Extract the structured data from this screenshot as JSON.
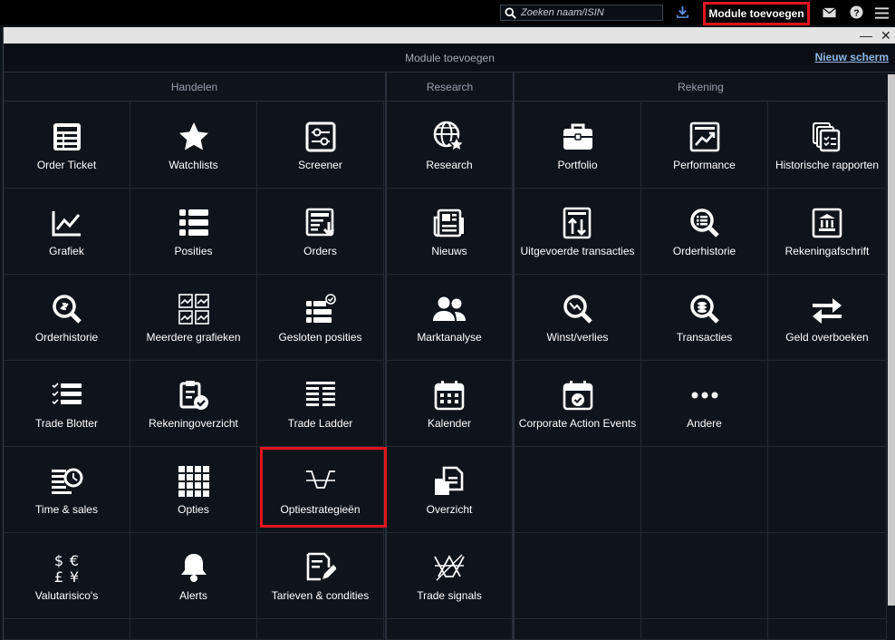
{
  "topbar": {
    "search_placeholder": "Zoeken naam/ISIN",
    "add_module_label": "Module toevoegen"
  },
  "window": {
    "title": "Module toevoegen",
    "new_screen_link": "Nieuw scherm",
    "minimize_glyph": "—",
    "close_glyph": "✕"
  },
  "sections": {
    "handelen": "Handelen",
    "research": "Research",
    "rekening": "Rekening"
  },
  "tiles": {
    "order_ticket": "Order Ticket",
    "watchlists": "Watchlists",
    "screener": "Screener",
    "grafiek": "Grafiek",
    "posities": "Posities",
    "orders": "Orders",
    "orderhistorie": "Orderhistorie",
    "meerdere_grafieken": "Meerdere grafieken",
    "gesloten_posities": "Gesloten posities",
    "trade_blotter": "Trade Blotter",
    "rekeningoverzicht": "Rekeningoverzicht",
    "trade_ladder": "Trade Ladder",
    "time_sales": "Time & sales",
    "opties": "Opties",
    "optiestrategieen": "Optiestrategieën",
    "valutarisico": "Valutarisico's",
    "alerts": "Alerts",
    "tarieven": "Tarieven & condities",
    "research": "Research",
    "nieuws": "Nieuws",
    "marktanalyse": "Marktanalyse",
    "kalender": "Kalender",
    "overzicht": "Overzicht",
    "trade_signals": "Trade signals",
    "portfolio": "Portfolio",
    "performance": "Performance",
    "historische_rapporten": "Historische rapporten",
    "uitgevoerde_transacties": "Uitgevoerde transacties",
    "orderhistorie_rek": "Orderhistorie",
    "rekeningafschrift": "Rekeningafschrift",
    "winst_verlies": "Winst/verlies",
    "transacties": "Transacties",
    "geld_overboeken": "Geld overboeken",
    "corporate_action": "Corporate Action Events",
    "andere": "Andere"
  },
  "colors": {
    "accent_red": "#e0161d",
    "link_blue": "#8fb8e8",
    "background": "#0f141b"
  }
}
